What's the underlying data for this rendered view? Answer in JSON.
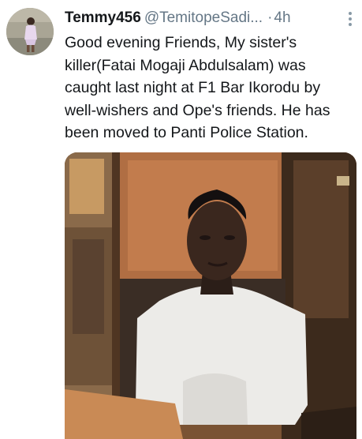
{
  "tweet": {
    "display_name": "Temmy456",
    "handle": "@TemitopeSadi...",
    "separator": "·",
    "time": "4h",
    "text_lines": [
      "Good evening Friends, My sister's",
      "killer(Fatai Mogaji Abdulsalam) was",
      "caught last night at F1 Bar Ikorodu by",
      "well-wishers and Ope's friends. He has",
      "been moved to Panti Police Station."
    ],
    "avatar_icon": "profile-photo",
    "more_icon": "more-vertical-icon",
    "media_description_icon": "attached-photo"
  }
}
